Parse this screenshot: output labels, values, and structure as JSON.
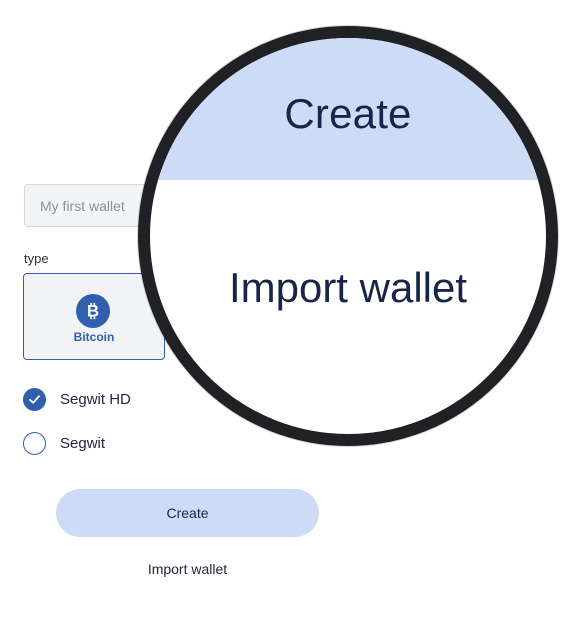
{
  "form": {
    "name_placeholder": "My first wallet",
    "type_label": "type",
    "coin": {
      "label": "Bitcoin",
      "icon": "bitcoin-icon",
      "selected": true
    },
    "address_types": [
      {
        "label": "Segwit HD",
        "checked": true
      },
      {
        "label": "Segwit",
        "checked": false
      }
    ],
    "create_label": "Create",
    "import_label": "Import wallet"
  },
  "magnifier": {
    "create_text": "Create",
    "import_text": "Import wallet"
  },
  "colors": {
    "accent": "#2f5fae",
    "button_bg": "#cddcf6",
    "text_dark": "#1c2541",
    "ring": "#202124"
  }
}
